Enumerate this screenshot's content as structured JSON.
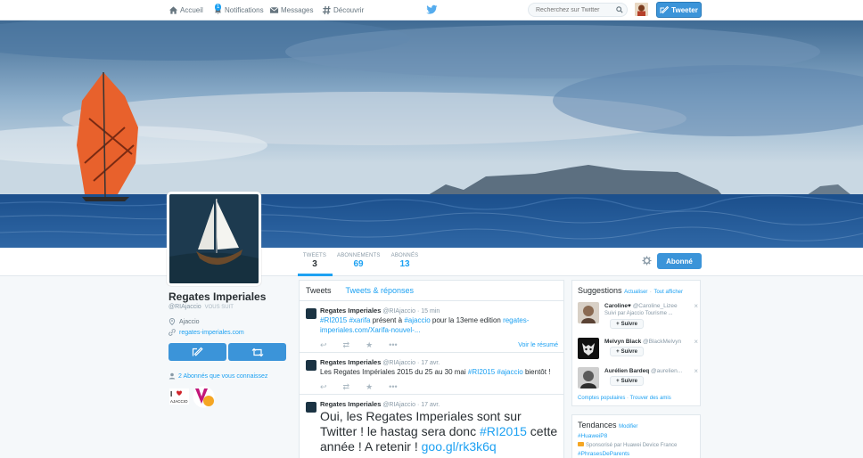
{
  "nav": {
    "home": "Accueil",
    "notifications": "Notifications",
    "notifications_count": "1",
    "messages": "Messages",
    "discover": "Découvrir",
    "search_placeholder": "Recherchez sur Twitter",
    "tweet_button": "Tweeter"
  },
  "profile": {
    "name": "Regates Imperiales",
    "handle": "@RIAjaccio",
    "follows_you": "VOUS SUIT",
    "location": "Ajaccio",
    "website": "regates-imperiales.com",
    "followers_you_know": "2 Abonnés que vous connaissez",
    "follow_state": "Abonné"
  },
  "stats": [
    {
      "label": "TWEETS",
      "value": "3"
    },
    {
      "label": "ABONNEMENTS",
      "value": "69"
    },
    {
      "label": "ABONNÉS",
      "value": "13"
    }
  ],
  "timeline": {
    "tabs": [
      "Tweets",
      "Tweets & réponses"
    ],
    "tweets": [
      {
        "name": "Regates Imperiales",
        "handle": "@RIAjaccio",
        "time": "· 15 min",
        "parts": [
          "#RI2015",
          " ",
          "#xarifa",
          " présent à ",
          "#ajaccio",
          " pour la 13eme edition ",
          "regates-imperiales.com/Xarifa-nouvel-..."
        ],
        "summary": "Voir le résumé"
      },
      {
        "name": "Regates Imperiales",
        "handle": "@RIAjaccio",
        "time": "· 17 avr.",
        "parts": [
          "Les Regates Impériales 2015 du 25 au 30 mai ",
          "#RI2015",
          " ",
          "#ajaccio",
          " bientôt !"
        ]
      },
      {
        "name": "Regates Imperiales",
        "handle": "@RIAjaccio",
        "time": "· 17 avr.",
        "parts": [
          "Oui, les Regates Imperiales sont sur Twitter ! le hastag sera donc ",
          "#RI2015",
          " cette année ! A retenir ! ",
          "goo.gl/rk3k6q"
        ]
      }
    ]
  },
  "suggestions": {
    "title": "Suggestions",
    "refresh": "Actualiser",
    "view_all": "Tout afficher",
    "items": [
      {
        "name": "Caroline♥",
        "handle": "@Caroline_Lizee",
        "sub": "Suivi par Ajaccio Tourisme ...",
        "follow": "Suivre"
      },
      {
        "name": "Melvyn Black",
        "handle": "@BlackMelvyn",
        "sub": "",
        "follow": "Suivre"
      },
      {
        "name": "Aurélien Bardeq",
        "handle": "@aurelien...",
        "sub": "",
        "follow": "Suivre"
      }
    ],
    "footer_popular": "Comptes populaires",
    "footer_friends": "Trouver des amis"
  },
  "trends": {
    "title": "Tendances",
    "modify": "Modifier",
    "items": [
      {
        "tag": "#HuaweiP8",
        "sponsored": "Sponsorisé par Huawei Device France"
      },
      {
        "tag": "#PhrasesDeParents",
        "sponsored": ""
      }
    ]
  },
  "colors": {
    "accent": "#1da1f2",
    "button": "#3b94d9",
    "sail": "#e8612c"
  }
}
